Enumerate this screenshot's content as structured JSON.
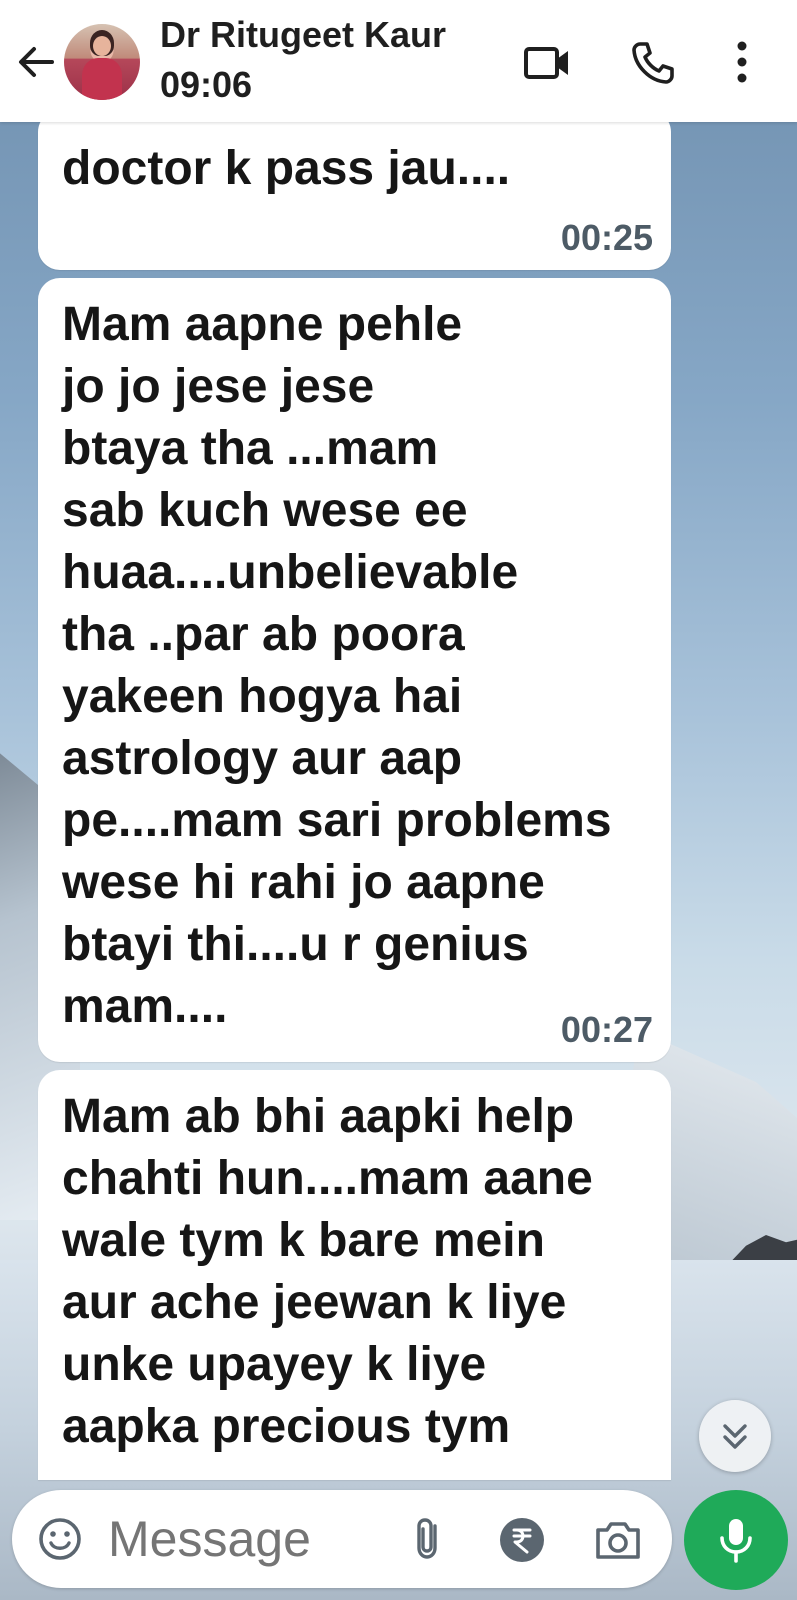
{
  "header": {
    "contact_name": "Dr Ritugeet Kaur",
    "contact_status": "09:06",
    "icons": {
      "back": "arrow-left-icon",
      "video": "video-camera-icon",
      "call": "phone-icon",
      "menu": "more-vertical-icon"
    }
  },
  "messages": [
    {
      "text": "doctor k pass jau....",
      "time": "00:25"
    },
    {
      "text": "Mam aapne pehle\njo jo jese jese\nbtaya tha ...mam\nsab kuch wese ee\nhuaa....unbelievable\ntha ..par ab poora\nyakeen hogya hai\nastrology aur aap\npe....mam sari problems\nwese hi rahi jo aapne\nbtayi thi....u r genius\nmam....",
      "time": "00:27"
    },
    {
      "text": "Mam ab bhi aapki help\nchahti hun....mam aane\nwale tym k bare mein\naur ache jeewan k liye\nunke upayey k liye\naapka precious tym",
      "time": ""
    }
  ],
  "composer": {
    "placeholder": "Message",
    "icons": {
      "emoji": "emoji-icon",
      "attach": "paperclip-icon",
      "payment": "rupee-icon",
      "camera": "camera-icon",
      "mic": "microphone-icon",
      "scroll": "chevrons-down-icon"
    }
  },
  "colors": {
    "header_bg": "#ffffff",
    "bubble_bg": "#ffffff",
    "time_text": "#4d5b66",
    "mic_button": "#1faa59"
  }
}
